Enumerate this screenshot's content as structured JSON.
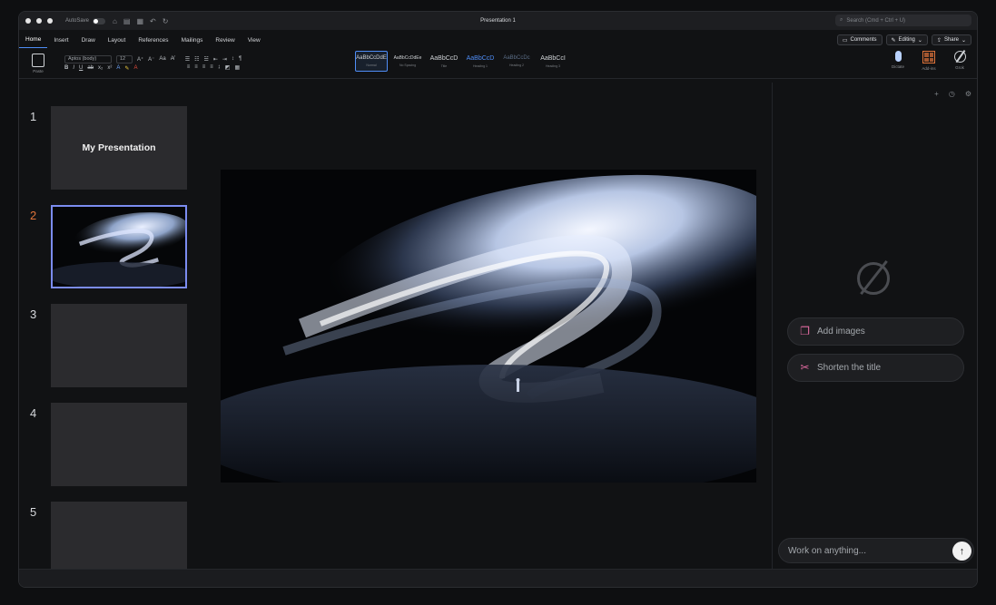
{
  "window": {
    "autosave_label": "AutoSave",
    "title": "Presentation 1",
    "search_placeholder": "Search (Cmd + Ctrl + U)"
  },
  "menu": {
    "tabs": [
      "Home",
      "Insert",
      "Draw",
      "Layout",
      "References",
      "Mailings",
      "Review",
      "View"
    ],
    "comments": "Comments",
    "editing": "Editing",
    "share": "Share"
  },
  "ribbon": {
    "paste": "Paste",
    "font_name": "Aptos (body)",
    "font_size": "12",
    "styles": [
      {
        "sample": "AaBbCcDdE",
        "name": "Normal"
      },
      {
        "sample": "AaBbCcDdEe",
        "name": "No Spacing"
      },
      {
        "sample": "AaBbCcD",
        "name": "Title"
      },
      {
        "sample": "AaBbCcD",
        "name": "Heading 1"
      },
      {
        "sample": "AaBbCcDc",
        "name": "Heading 2"
      },
      {
        "sample": "AaBbCcI",
        "name": "Heading 3"
      }
    ],
    "dictate": "Dictate",
    "addins": "Add-ins",
    "grok": "Grok"
  },
  "slides": [
    {
      "number": "1",
      "title": "My Presentation"
    },
    {
      "number": "2",
      "title": ""
    },
    {
      "number": "3",
      "title": ""
    },
    {
      "number": "4",
      "title": ""
    },
    {
      "number": "5",
      "title": ""
    }
  ],
  "side_panel": {
    "suggestions": [
      "Add images",
      "Shorten the title"
    ],
    "chat_placeholder": "Work on anything..."
  },
  "colors": {
    "accent": "#4f8df6",
    "active_slide_number": "#e0743a",
    "selection_border": "#7b8cf0"
  }
}
